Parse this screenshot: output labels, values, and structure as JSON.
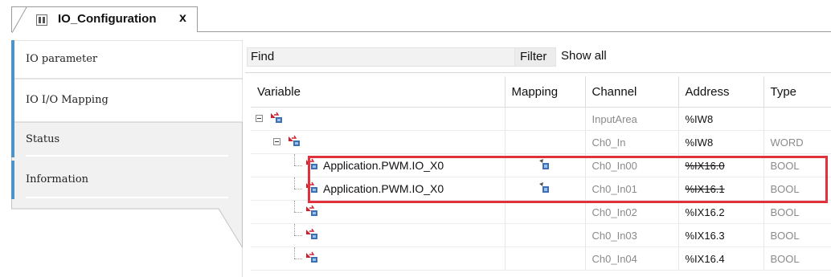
{
  "tab": {
    "title": "IO_Configuration",
    "close_glyph": "x",
    "icon": "device-icon"
  },
  "nav": {
    "items": [
      {
        "label": "IO parameter",
        "active": false
      },
      {
        "label": "IO I/O Mapping",
        "active": true
      },
      {
        "label": "Status",
        "active": false
      },
      {
        "label": "Information",
        "active": false
      }
    ],
    "accent_color": "#4f93c8"
  },
  "toolbar": {
    "find_label": "Find",
    "filter_label": "Filter",
    "filter_value": "Show all"
  },
  "table": {
    "columns": [
      "Variable",
      "Mapping",
      "Channel",
      "Address",
      "Type"
    ],
    "rows": [
      {
        "variable": "",
        "mapping": false,
        "channel": "InputArea",
        "address": "%IW8",
        "type": "",
        "strike": false
      },
      {
        "variable": "",
        "mapping": false,
        "channel": "Ch0_In",
        "address": "%IW8",
        "type": "WORD",
        "strike": false
      },
      {
        "variable": "Application.PWM.IO_X0",
        "mapping": true,
        "channel": "Ch0_In00",
        "address": "%IX16.0",
        "type": "BOOL",
        "strike": true
      },
      {
        "variable": "Application.PWM.IO_X0",
        "mapping": true,
        "channel": "Ch0_In01",
        "address": "%IX16.1",
        "type": "BOOL",
        "strike": true
      },
      {
        "variable": "",
        "mapping": false,
        "channel": "Ch0_In02",
        "address": "%IX16.2",
        "type": "BOOL",
        "strike": false
      },
      {
        "variable": "",
        "mapping": false,
        "channel": "Ch0_In03",
        "address": "%IX16.3",
        "type": "BOOL",
        "strike": false
      },
      {
        "variable": "",
        "mapping": false,
        "channel": "Ch0_In04",
        "address": "%IX16.4",
        "type": "BOOL",
        "strike": false
      }
    ]
  },
  "colors": {
    "highlight_border": "#e0313c"
  }
}
